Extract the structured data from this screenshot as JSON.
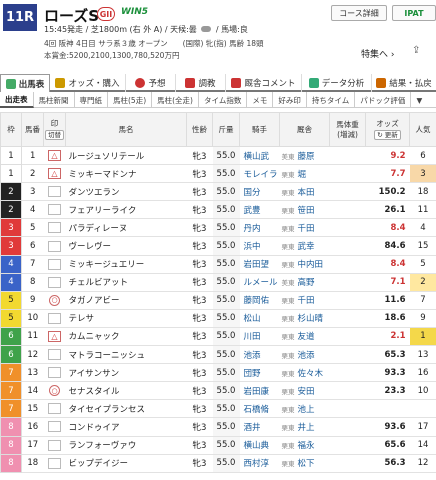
{
  "race": {
    "number": "11R",
    "name": "ローズS",
    "grade": "GII",
    "win5": "WIN5",
    "time_course": "15:45発走 / 芝1800m (右 外 A) / 天候:曇",
    "track": "/ 馬場:良",
    "detail1": "4回 阪神 4日目 サラ系３歳 オープン　　(国際) 牝(指) 馬齢 18頭",
    "detail2": "本賞金:5200,2100,1300,780,520万円",
    "course_button": "コース詳細",
    "ipat_button": "IPAT",
    "tokubetsu": "特集へ",
    "share_icon": "share-icon"
  },
  "tabs": [
    {
      "label": "出馬表",
      "icon_color": "#4a6"
    },
    {
      "label": "オッズ・購入",
      "icon_color": "#c90"
    },
    {
      "label": "予想",
      "icon_color": "#c33"
    },
    {
      "label": "調教",
      "icon_color": "#c33"
    },
    {
      "label": "厩舎コメント",
      "icon_color": "#c33"
    },
    {
      "label": "データ分析",
      "icon_color": "#3a7"
    },
    {
      "label": "結果・払戻",
      "icon_color": "#c60"
    }
  ],
  "subtabs": [
    "出走表",
    "馬柱新聞",
    "専門紙",
    "馬柱(5走)",
    "馬柱(全走)",
    "タイム指数",
    "メモ",
    "好み印",
    "持ちタイム",
    "パドック評価",
    "▼"
  ],
  "columns": {
    "waku": "枠",
    "umaban": "馬番",
    "mark": "印",
    "mark_sort": "切替",
    "name": "馬名",
    "sexage": "性齢",
    "weight": "斤量",
    "jockey": "騎手",
    "trainer": "厩舎",
    "bodyweight": "馬体重 (増減)",
    "odds": "オッズ",
    "odds_update": "更新",
    "pop": "人気"
  },
  "horses": [
    {
      "waku": "1",
      "umaban": "1",
      "mark": "warn",
      "name": "ルージュソリテール",
      "sexage": "牝3",
      "weight": "55.0",
      "jockey": "横山武",
      "loc": "美東",
      "trainer": "藤原",
      "odds": "9.2",
      "hot": true,
      "pop": "6"
    },
    {
      "waku": "1",
      "umaban": "2",
      "mark": "warn",
      "name": "ミッキーマドンナ",
      "sexage": "牝3",
      "weight": "55.0",
      "jockey": "モレイラ",
      "loc": "栗東",
      "trainer": "堀",
      "odds": "7.7",
      "hot": true,
      "pop": "3"
    },
    {
      "waku": "2",
      "umaban": "3",
      "mark": "",
      "name": "ダンツエラン",
      "sexage": "牝3",
      "weight": "55.0",
      "jockey": "国分",
      "loc": "栗東",
      "trainer": "本田",
      "odds": "150.2",
      "hot": false,
      "pop": "18"
    },
    {
      "waku": "2",
      "umaban": "4",
      "mark": "",
      "name": "フェアリーライク",
      "sexage": "牝3",
      "weight": "55.0",
      "jockey": "武豊",
      "loc": "栗東",
      "trainer": "笹田",
      "odds": "26.1",
      "hot": false,
      "pop": "11"
    },
    {
      "waku": "3",
      "umaban": "5",
      "mark": "",
      "name": "パラディレーヌ",
      "sexage": "牝3",
      "weight": "55.0",
      "jockey": "丹内",
      "loc": "栗東",
      "trainer": "千田",
      "odds": "8.4",
      "hot": true,
      "pop": "4"
    },
    {
      "waku": "3",
      "umaban": "6",
      "mark": "",
      "name": "ヴーレヴー",
      "sexage": "牝3",
      "weight": "55.0",
      "jockey": "浜中",
      "loc": "栗東",
      "trainer": "武幸",
      "odds": "84.6",
      "hot": false,
      "pop": "15"
    },
    {
      "waku": "4",
      "umaban": "7",
      "mark": "",
      "name": "ミッキージュエリー",
      "sexage": "牝3",
      "weight": "55.0",
      "jockey": "岩田望",
      "loc": "栗東",
      "trainer": "中内田",
      "odds": "8.4",
      "hot": true,
      "pop": "5"
    },
    {
      "waku": "4",
      "umaban": "8",
      "mark": "",
      "name": "チェルビアット",
      "sexage": "牝3",
      "weight": "55.0",
      "jockey": "ルメール",
      "loc": "美東",
      "trainer": "高野",
      "odds": "7.1",
      "hot": true,
      "pop": "2"
    },
    {
      "waku": "5",
      "umaban": "9",
      "mark": "circ",
      "name": "タガノアビー",
      "sexage": "牝3",
      "weight": "55.0",
      "jockey": "藤岡佑",
      "loc": "栗東",
      "trainer": "千田",
      "odds": "11.6",
      "hot": false,
      "pop": "7"
    },
    {
      "waku": "5",
      "umaban": "10",
      "mark": "",
      "name": "テレサ",
      "sexage": "牝3",
      "weight": "55.0",
      "jockey": "松山",
      "loc": "栗東",
      "trainer": "杉山晴",
      "odds": "18.6",
      "hot": false,
      "pop": "9"
    },
    {
      "waku": "6",
      "umaban": "11",
      "mark": "warn",
      "name": "カムニャック",
      "sexage": "牝3",
      "weight": "55.0",
      "jockey": "川田",
      "loc": "栗東",
      "trainer": "友道",
      "odds": "2.1",
      "hot": true,
      "pop": "1"
    },
    {
      "waku": "6",
      "umaban": "12",
      "mark": "",
      "name": "マトラコーニッシュ",
      "sexage": "牝3",
      "weight": "55.0",
      "jockey": "池添",
      "loc": "栗東",
      "trainer": "池添",
      "odds": "65.3",
      "hot": false,
      "pop": "13"
    },
    {
      "waku": "7",
      "umaban": "13",
      "mark": "",
      "name": "アイサンサン",
      "sexage": "牝3",
      "weight": "55.0",
      "jockey": "団野",
      "loc": "栗東",
      "trainer": "佐々木",
      "odds": "93.3",
      "hot": false,
      "pop": "16"
    },
    {
      "waku": "7",
      "umaban": "14",
      "mark": "circ",
      "name": "セナスタイル",
      "sexage": "牝3",
      "weight": "55.0",
      "jockey": "岩田康",
      "loc": "栗東",
      "trainer": "安田",
      "odds": "23.3",
      "hot": false,
      "pop": "10"
    },
    {
      "waku": "7",
      "umaban": "15",
      "mark": "",
      "name": "タイセイプランセス",
      "sexage": "牝3",
      "weight": "55.0",
      "jockey": "石橋脩",
      "loc": "栗東",
      "trainer": "池上",
      "odds": "",
      "hot": false,
      "pop": ""
    },
    {
      "waku": "8",
      "umaban": "16",
      "mark": "",
      "name": "コンドゥイア",
      "sexage": "牝3",
      "weight": "55.0",
      "jockey": "酒井",
      "loc": "栗東",
      "trainer": "井上",
      "odds": "93.6",
      "hot": false,
      "pop": "17"
    },
    {
      "waku": "8",
      "umaban": "17",
      "mark": "",
      "name": "ランフォーヴァウ",
      "sexage": "牝3",
      "weight": "55.0",
      "jockey": "横山典",
      "loc": "栗東",
      "trainer": "福永",
      "odds": "65.6",
      "hot": false,
      "pop": "14"
    },
    {
      "waku": "8",
      "umaban": "18",
      "mark": "",
      "name": "ビップデイジー",
      "sexage": "牝3",
      "weight": "55.0",
      "jockey": "西村淳",
      "loc": "栗東",
      "trainer": "松下",
      "odds": "56.3",
      "hot": false,
      "pop": "12"
    }
  ],
  "waku_colors": {
    "1": {
      "bg": "#ffffff",
      "fg": "#222222"
    },
    "2": {
      "bg": "#222222",
      "fg": "#ffffff"
    },
    "3": {
      "bg": "#e03a3a",
      "fg": "#ffffff"
    },
    "4": {
      "bg": "#3a63c8",
      "fg": "#ffffff"
    },
    "5": {
      "bg": "#f2d930",
      "fg": "#222222"
    },
    "6": {
      "bg": "#3fa24a",
      "fg": "#ffffff"
    },
    "7": {
      "bg": "#f0902a",
      "fg": "#ffffff"
    },
    "8": {
      "bg": "#f090b0",
      "fg": "#ffffff"
    }
  }
}
